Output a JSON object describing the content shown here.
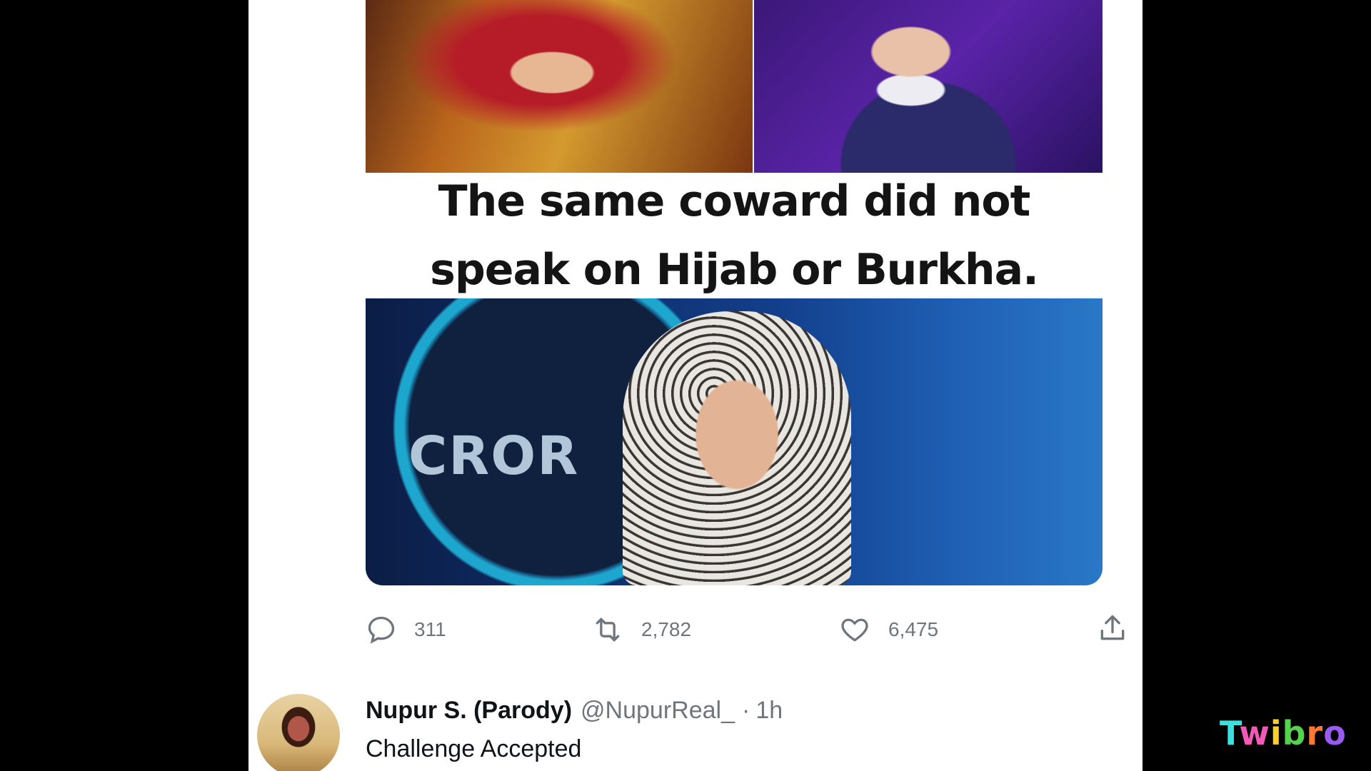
{
  "tweet": {
    "image_caption": {
      "line1": "The same coward did not",
      "line2": "speak on Hijab or Burkha."
    },
    "image_bottom_text": "CROR",
    "actions": {
      "reply_icon": "comment-bubble-icon",
      "reply_count": "311",
      "retweet_icon": "retweet-icon",
      "retweet_count": "2,782",
      "like_icon": "heart-icon",
      "like_count": "6,475",
      "share_icon": "share-upload-icon"
    }
  },
  "reply": {
    "display_name": "Nupur S. (Parody)",
    "handle": "@NupurReal_",
    "separator": "·",
    "time": "1h",
    "text": "Challenge Accepted"
  },
  "watermark": {
    "letters": [
      "T",
      "w",
      "i",
      "b",
      "r",
      "o"
    ]
  },
  "colors": {
    "background_letterbox": "#000000",
    "panel": "#ffffff",
    "muted_text": "#6e767d",
    "primary_text": "#0f1419"
  }
}
